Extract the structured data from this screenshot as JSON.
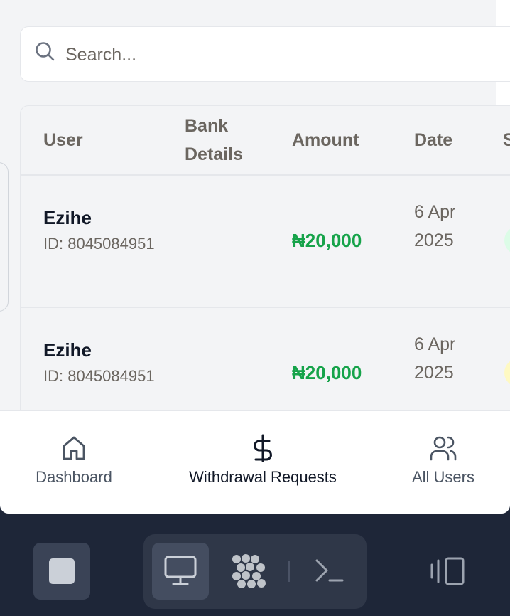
{
  "search": {
    "placeholder": "Search..."
  },
  "table": {
    "headers": {
      "user": "User",
      "bank": "Bank Details",
      "amount": "Amount",
      "date": "Date",
      "status": "S"
    },
    "rows": [
      {
        "name": "Ezihe",
        "id": "ID: 8045084951",
        "amount": "₦20,000",
        "date": "6 Apr 2025",
        "status_color": "#dcfce7"
      },
      {
        "name": "Ezihe",
        "id": "ID: 8045084951",
        "amount": "₦20,000",
        "date": "6 Apr 2025",
        "status_color": "#fef9c3"
      }
    ]
  },
  "bottom_nav": {
    "items": [
      {
        "label": "Dashboard",
        "icon": "home-icon"
      },
      {
        "label": "Withdrawal Requests",
        "icon": "dollar-icon",
        "active": true
      },
      {
        "label": "All Users",
        "icon": "users-icon"
      }
    ]
  },
  "taskbar": {
    "icons": [
      "stop-icon",
      "monitor-icon",
      "app-grid-icon",
      "terminal-icon",
      "panel-icon"
    ]
  },
  "colors": {
    "amount_green": "#16a34a",
    "taskbar_bg": "#1e2638"
  }
}
